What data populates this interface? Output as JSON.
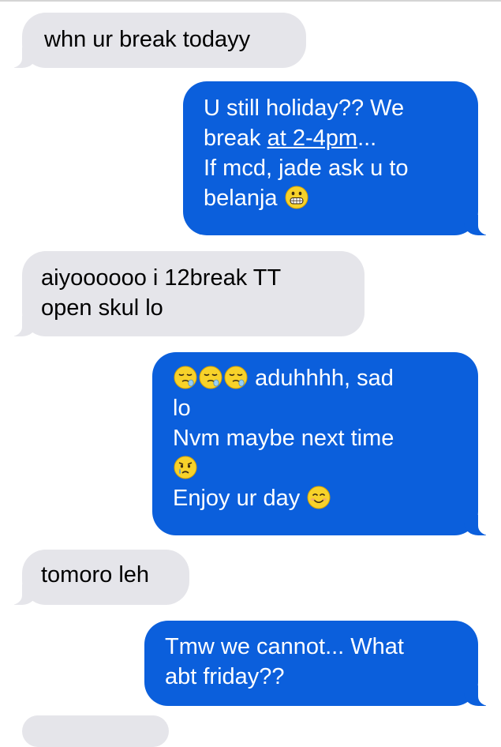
{
  "conversation": {
    "messages": [
      {
        "direction": "incoming",
        "lines": [
          {
            "text": "whn ur break todayy"
          }
        ]
      },
      {
        "direction": "outgoing",
        "lines": [
          {
            "text": "U still holiday?? We"
          },
          {
            "pre": "break ",
            "link": "at 2-4pm",
            "post": "..."
          },
          {
            "text": "If mcd, jade ask u to"
          },
          {
            "text": "belanja",
            "emoji": "grimacing-face-emoji"
          }
        ]
      },
      {
        "direction": "incoming",
        "lines": [
          {
            "text": "aiyoooooo i 12break TT"
          },
          {
            "text": "open skul lo"
          }
        ]
      },
      {
        "direction": "outgoing",
        "lines": [
          {
            "emojis": [
              "sleepy-face-emoji",
              "sleepy-face-emoji",
              "sleepy-face-emoji"
            ],
            "text": "aduhhhh, sad"
          },
          {
            "text": "lo"
          },
          {
            "text": "Nvm maybe next time"
          },
          {
            "emoji_only": "crying-face-emoji"
          },
          {
            "text": "Enjoy ur day",
            "emoji": "smiling-face-emoji"
          }
        ]
      },
      {
        "direction": "incoming",
        "lines": [
          {
            "text": "tomoro leh"
          }
        ]
      },
      {
        "direction": "outgoing",
        "lines": [
          {
            "text": "Tmw we cannot... What"
          },
          {
            "text": "abt friday??"
          }
        ]
      }
    ]
  },
  "colors": {
    "incoming_bubble": "#e5e5ea",
    "outgoing_bubble": "#0b5fdc",
    "incoming_text": "#000000",
    "outgoing_text": "#ffffff"
  }
}
